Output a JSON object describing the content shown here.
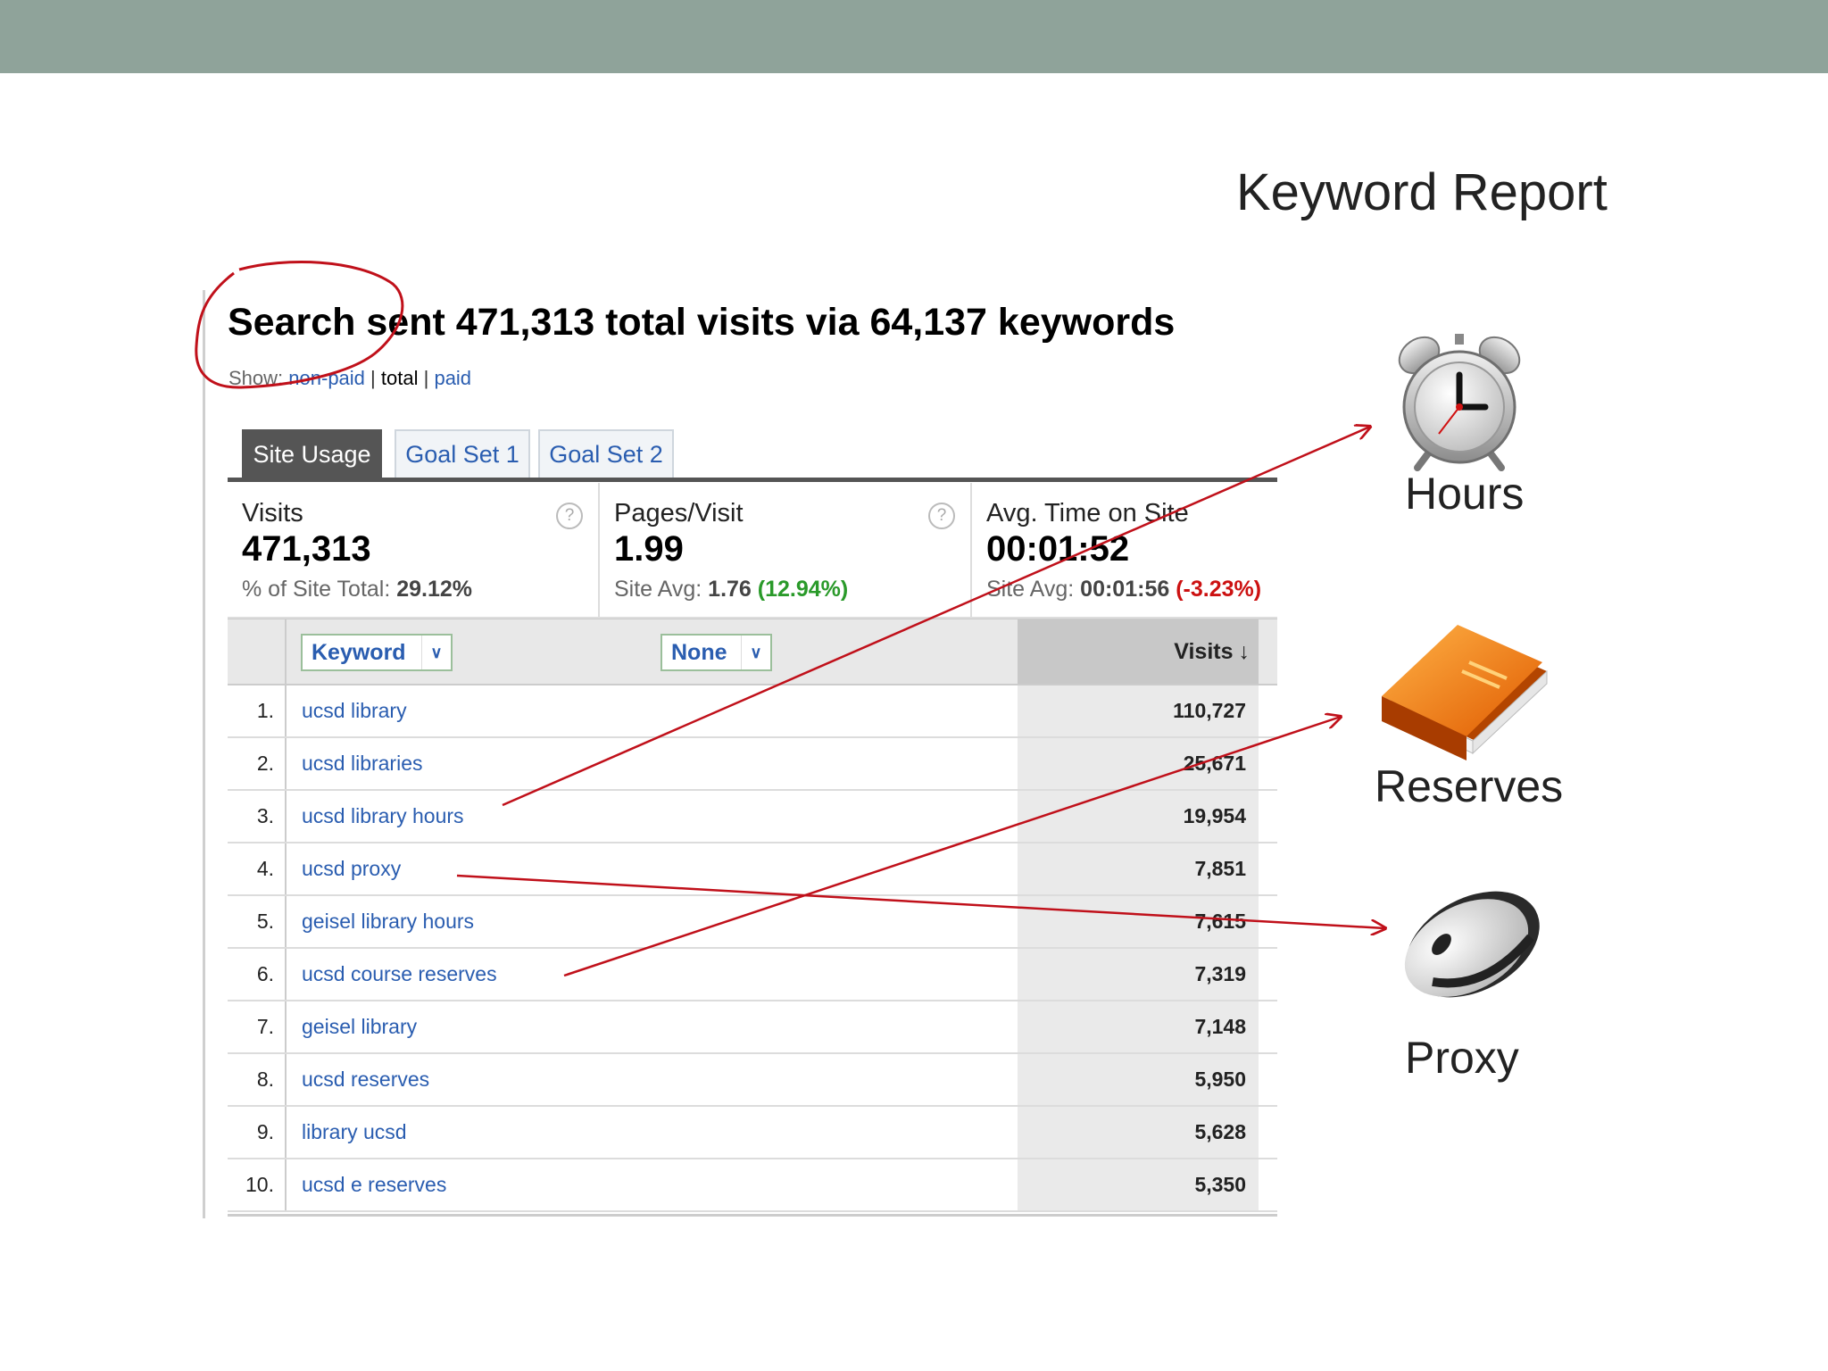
{
  "slide": {
    "title": "Keyword Report"
  },
  "report": {
    "headline": "Search sent 471,313 total visits via 64,137 keywords",
    "show": {
      "label": "Show:",
      "non_paid": "non-paid",
      "total": "total",
      "paid": "paid"
    },
    "tabs": [
      {
        "label": "Site Usage",
        "active": true
      },
      {
        "label": "Goal Set 1",
        "active": false
      },
      {
        "label": "Goal Set 2",
        "active": false
      }
    ],
    "metrics": {
      "visits": {
        "label": "Visits",
        "value": "471,313",
        "sub_label": "% of Site Total:",
        "sub_value": "29.12%"
      },
      "pages": {
        "label": "Pages/Visit",
        "value": "1.99",
        "sub_label": "Site Avg:",
        "sub_value": "1.76",
        "change": "(12.94%)"
      },
      "time": {
        "label": "Avg. Time on Site",
        "value": "00:01:52",
        "sub_label": "Site Avg:",
        "sub_value": "00:01:56",
        "change": "(-3.23%)"
      }
    },
    "table": {
      "dim1": "Keyword",
      "dim2": "None",
      "col_visits": "Visits",
      "rows": [
        {
          "num": "1.",
          "keyword": "ucsd library",
          "visits": "110,727"
        },
        {
          "num": "2.",
          "keyword": "ucsd libraries",
          "visits": "25,671"
        },
        {
          "num": "3.",
          "keyword": "ucsd library hours",
          "visits": "19,954"
        },
        {
          "num": "4.",
          "keyword": "ucsd proxy",
          "visits": "7,851"
        },
        {
          "num": "5.",
          "keyword": "geisel library hours",
          "visits": "7,615"
        },
        {
          "num": "6.",
          "keyword": "ucsd course reserves",
          "visits": "7,319"
        },
        {
          "num": "7.",
          "keyword": "geisel library",
          "visits": "7,148"
        },
        {
          "num": "8.",
          "keyword": "ucsd reserves",
          "visits": "5,950"
        },
        {
          "num": "9.",
          "keyword": "library ucsd",
          "visits": "5,628"
        },
        {
          "num": "10.",
          "keyword": "ucsd e reserves",
          "visits": "5,350"
        }
      ]
    }
  },
  "callouts": [
    {
      "label": "Hours",
      "icon": "alarm-clock-icon"
    },
    {
      "label": "Reserves",
      "icon": "book-icon"
    },
    {
      "label": "Proxy",
      "icon": "mouse-icon"
    }
  ],
  "colors": {
    "topbar": "#8fa39a",
    "annotation": "#c0101a",
    "link": "#2a5db0",
    "positive": "#2a9a2a",
    "negative": "#cc1111"
  }
}
